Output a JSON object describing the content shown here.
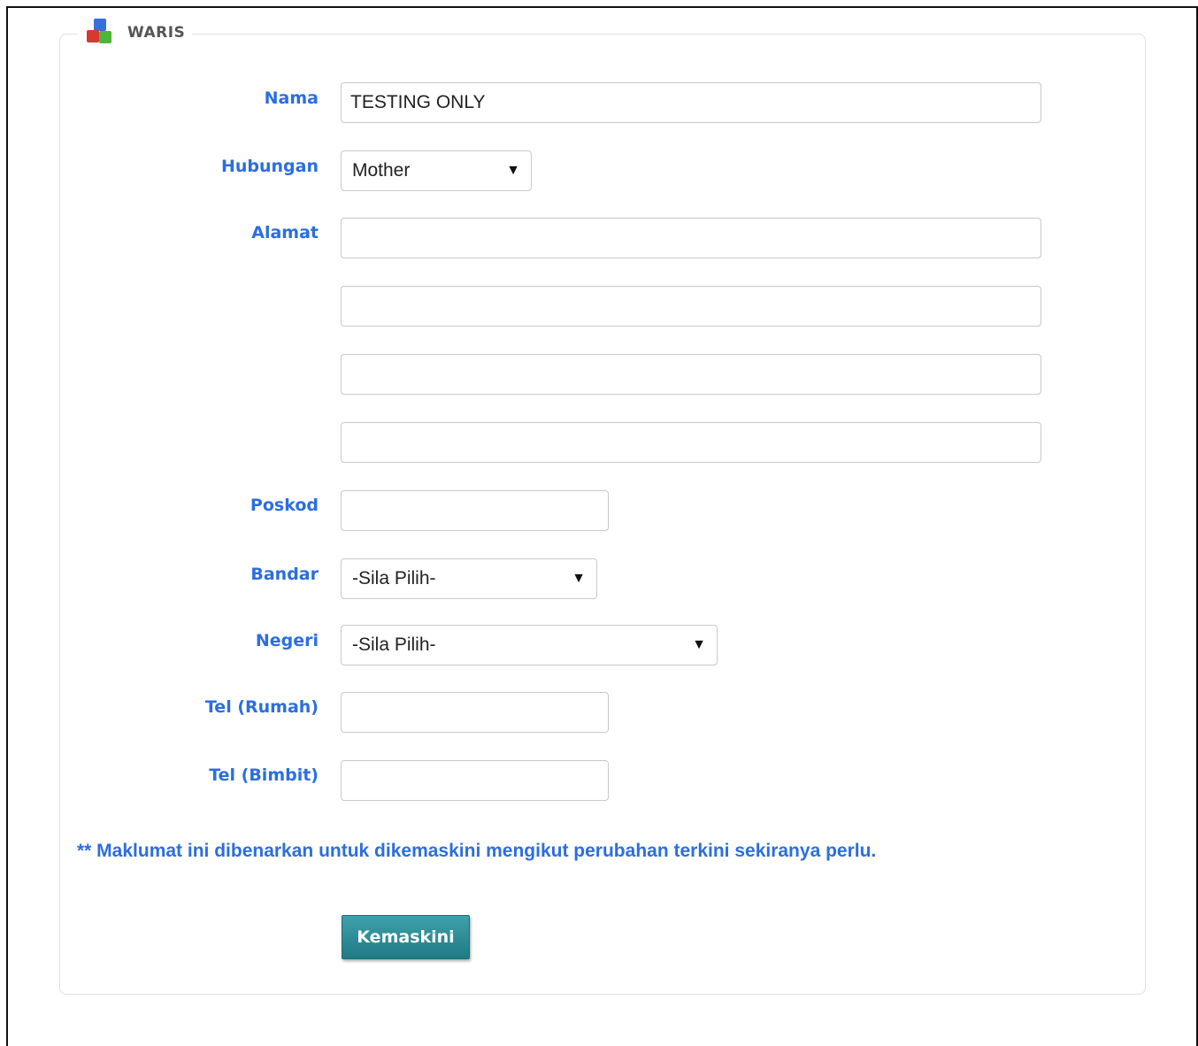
{
  "section": {
    "title": "WARIS",
    "icon": "blocks-icon"
  },
  "form": {
    "nama": {
      "label": "Nama",
      "value": "TESTING ONLY",
      "placeholder": ""
    },
    "hubungan": {
      "label": "Hubungan",
      "selected": "Mother"
    },
    "alamat": {
      "label": "Alamat",
      "line1": "",
      "line2": "",
      "line3": "",
      "line4": ""
    },
    "poskod": {
      "label": "Poskod",
      "value": ""
    },
    "bandar": {
      "label": "Bandar",
      "selected": "-Sila Pilih-"
    },
    "negeri": {
      "label": "Negeri",
      "selected": "-Sila Pilih-"
    },
    "tel_rumah": {
      "label": "Tel (Rumah)",
      "value": ""
    },
    "tel_bimbit": {
      "label": "Tel (Bimbit)",
      "value": ""
    }
  },
  "note": "** Maklumat ini dibenarkan untuk dikemaskini mengikut perubahan terkini sekiranya perlu.",
  "submit_label": "Kemaskini",
  "colors": {
    "label": "#2b6ee0",
    "button": "#2a8a94"
  }
}
